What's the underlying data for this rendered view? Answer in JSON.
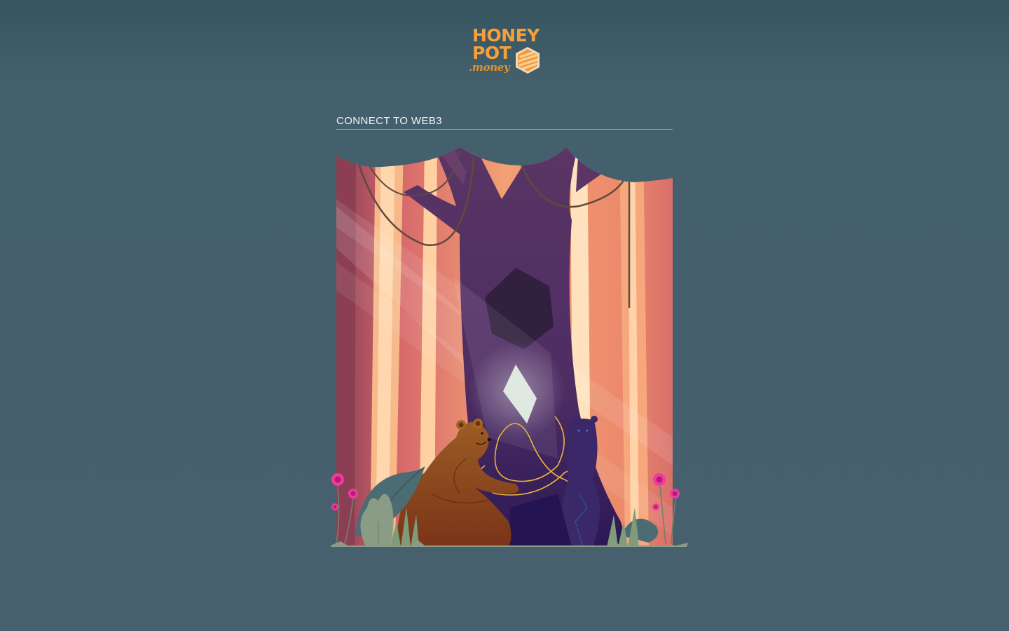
{
  "logo": {
    "line1": "HONEY",
    "line2": "POT",
    "line3": ".money",
    "icon": "honeycomb-hexagon-icon",
    "color": "#f5a03c"
  },
  "connect": {
    "title": "CONNECT TO WEB3"
  },
  "illustration": {
    "icons": [
      "bear",
      "shadow-bear",
      "ethereum-diamond",
      "hexagon-hole",
      "forest-trees",
      "pink-flower",
      "leaf"
    ]
  },
  "colors": {
    "background": "#46616d",
    "accent": "#e08b3b",
    "tree": "#5a3565"
  }
}
